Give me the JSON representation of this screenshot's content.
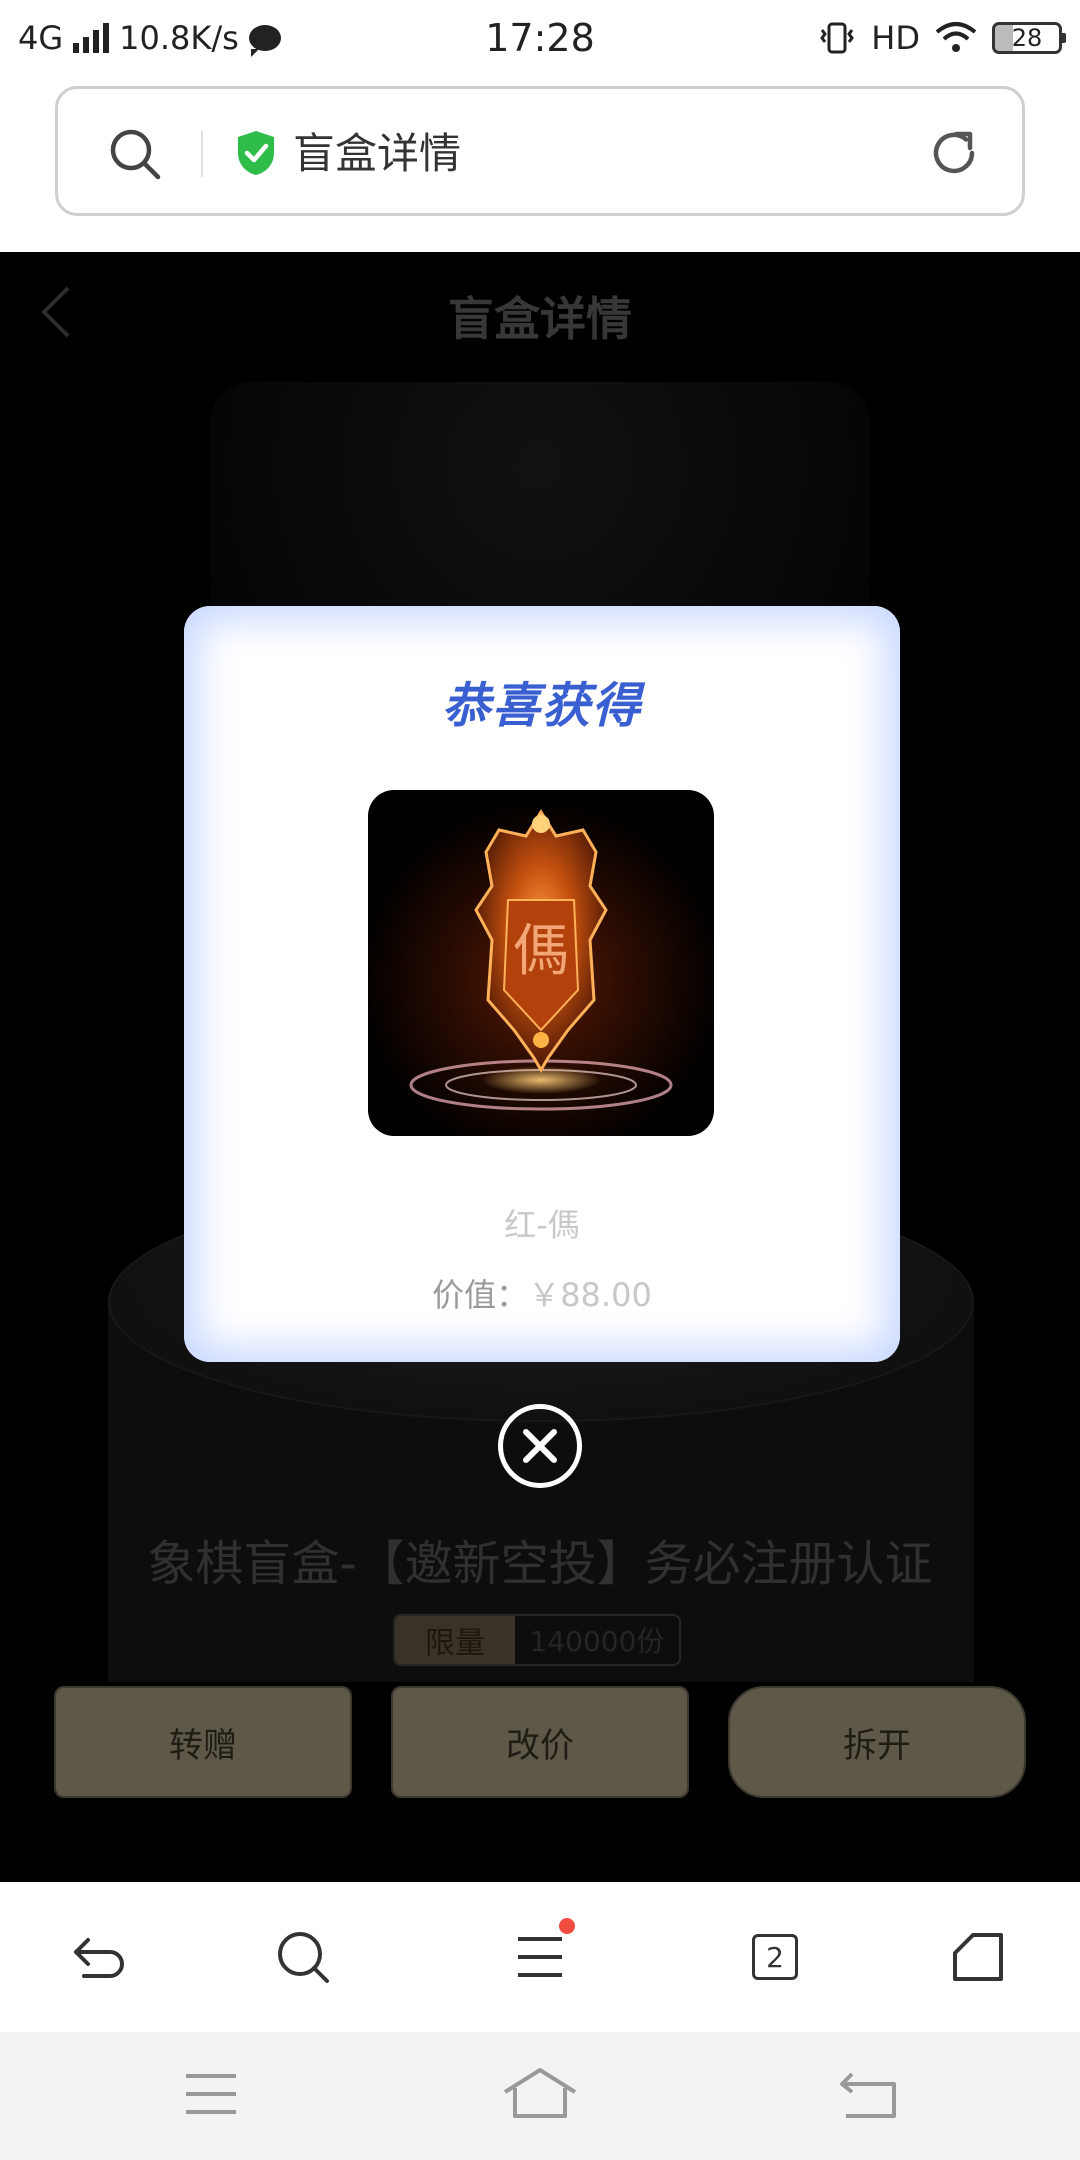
{
  "status_bar": {
    "network": "4G",
    "speed": "10.8K/s",
    "time": "17:28",
    "hd": "HD",
    "battery": "28"
  },
  "address_bar": {
    "text": "盲盒详情"
  },
  "page": {
    "title": "盲盒详情",
    "box_name": "象棋盲盒-【邀新空投】务必注册认证",
    "limit_label": "限量",
    "limit_count": "140000份"
  },
  "actions": {
    "gift_label": "转赠",
    "reprice_label": "改价",
    "open_label": "拆开"
  },
  "modal": {
    "title": "恭喜获得",
    "prize_name": "红-傌",
    "value_label": "价值：",
    "value": "￥88.00",
    "piece_char": "傌"
  },
  "toolbar": {
    "tabs_count": "2"
  },
  "colors": {
    "modal_title": "#3a5fd0",
    "action_button": "#5e5848",
    "red_dot": "#f24b3f",
    "shield_green": "#2fbd4a"
  }
}
